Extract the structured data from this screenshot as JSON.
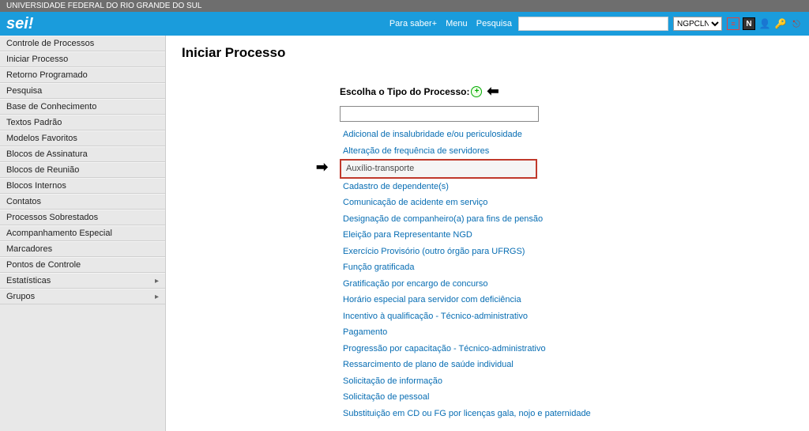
{
  "org_bar": "UNIVERSIDADE FEDERAL DO RIO GRANDE DO SUL",
  "logo_text": "sei!",
  "top_links": {
    "help": "Para saber+",
    "menu": "Menu",
    "search_label": "Pesquisa"
  },
  "search_value": "",
  "unit_selected": "NGPCLN",
  "sidebar": {
    "items": [
      "Controle de Processos",
      "Iniciar Processo",
      "Retorno Programado",
      "Pesquisa",
      "Base de Conhecimento",
      "Textos Padrão",
      "Modelos Favoritos",
      "Blocos de Assinatura",
      "Blocos de Reunião",
      "Blocos Internos",
      "Contatos",
      "Processos Sobrestados",
      "Acompanhamento Especial",
      "Marcadores",
      "Pontos de Controle",
      "Estatísticas",
      "Grupos"
    ]
  },
  "page_title": "Iniciar Processo",
  "form_label": "Escolha o Tipo do Processo:",
  "type_filter": "",
  "process_types": [
    "Adicional de insalubridade e/ou periculosidade",
    "Alteração de frequência de servidores",
    "Auxílio-transporte",
    "Cadastro de dependente(s)",
    "Comunicação de acidente em serviço",
    "Designação de companheiro(a) para fins de pensão",
    "Eleição para Representante NGD",
    "Exercício Provisório (outro órgão para UFRGS)",
    "Função gratificada",
    "Gratificação por encargo de concurso",
    "Horário especial para servidor com deficiência",
    "Incentivo à qualificação - Técnico-administrativo",
    "Pagamento",
    "Progressão por capacitação - Técnico-administrativo",
    "Ressarcimento de plano de saúde individual",
    "Solicitação de informação",
    "Solicitação de pessoal",
    "Substituição em CD ou FG por licenças gala, nojo e paternidade"
  ],
  "highlighted_index": 2
}
